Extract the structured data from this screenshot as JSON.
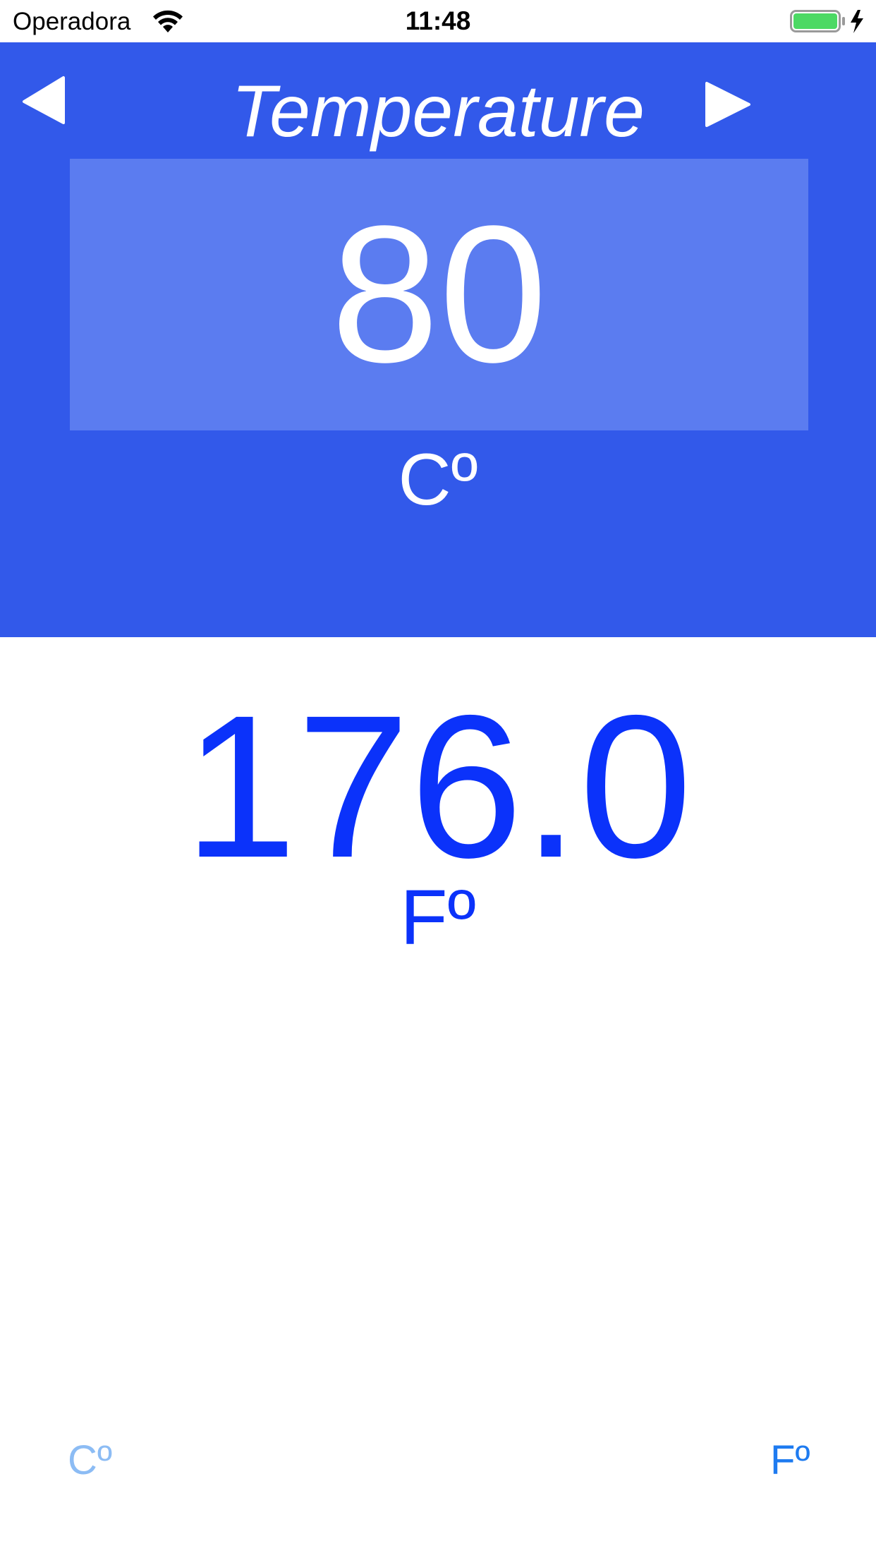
{
  "status_bar": {
    "carrier": "Operadora",
    "time": "11:48",
    "wifi_icon": "wifi-icon",
    "battery_icon": "battery-charging-icon",
    "battery_color": "#4cd964"
  },
  "header": {
    "title": "Temperature",
    "prev_icon": "triangle-left-icon",
    "next_icon": "triangle-right-icon",
    "background_color": "#3259ea"
  },
  "input": {
    "value": "80",
    "unit": "Cº",
    "box_color": "#5b7cf0"
  },
  "result": {
    "value": "176.0",
    "unit": "Fº",
    "color": "#0b32fa"
  },
  "unit_toggles": {
    "celsius_label": "Cº",
    "fahrenheit_label": "Fº",
    "celsius_color": "#8cbcf4",
    "fahrenheit_color": "#1e7bf0"
  }
}
